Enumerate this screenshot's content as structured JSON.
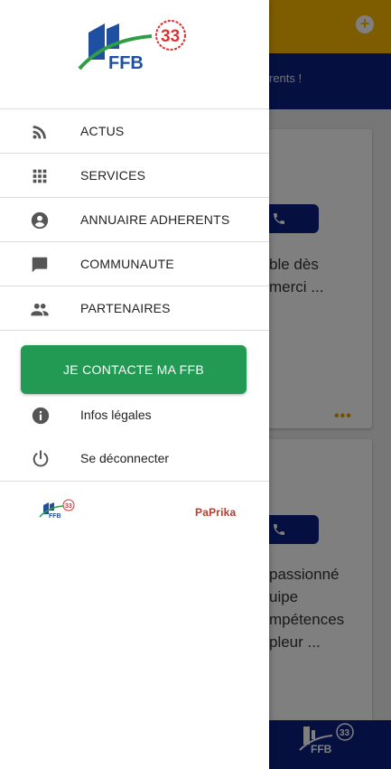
{
  "app": {
    "banner_text": "rents !",
    "card1": {
      "text": "ble dès\nmerci ..."
    },
    "card2": {
      "text": "passionné\nuipe\nmpétences\npleur ..."
    },
    "more": "•••",
    "add_icon": "plus-circle-icon",
    "call_icon": "phone-icon"
  },
  "drawer": {
    "logo": {
      "badge": "33",
      "text": "FFB"
    },
    "menu": [
      {
        "label": "ACTUS",
        "icon": "rss-icon"
      },
      {
        "label": "SERVICES",
        "icon": "grid-icon"
      },
      {
        "label": "ANNUAIRE ADHERENTS",
        "icon": "account-circle-icon"
      },
      {
        "label": "COMMUNAUTE",
        "icon": "chat-bubble-icon"
      },
      {
        "label": "PARTENAIRES",
        "icon": "people-icon"
      }
    ],
    "contact_button": "JE CONTACTE MA FFB",
    "legal": {
      "label": "Infos légales",
      "icon": "info-icon"
    },
    "logout": {
      "label": "Se déconnecter",
      "icon": "power-icon"
    },
    "footer": {
      "ffb_badge": "33",
      "ffb_text": "FFB",
      "paprika": "PaPrika"
    }
  },
  "colors": {
    "topbar": "#fcb900",
    "navy": "#0a2080",
    "green_button": "#239a53",
    "logo_green": "#2e9e45",
    "logo_red": "#e03030"
  }
}
